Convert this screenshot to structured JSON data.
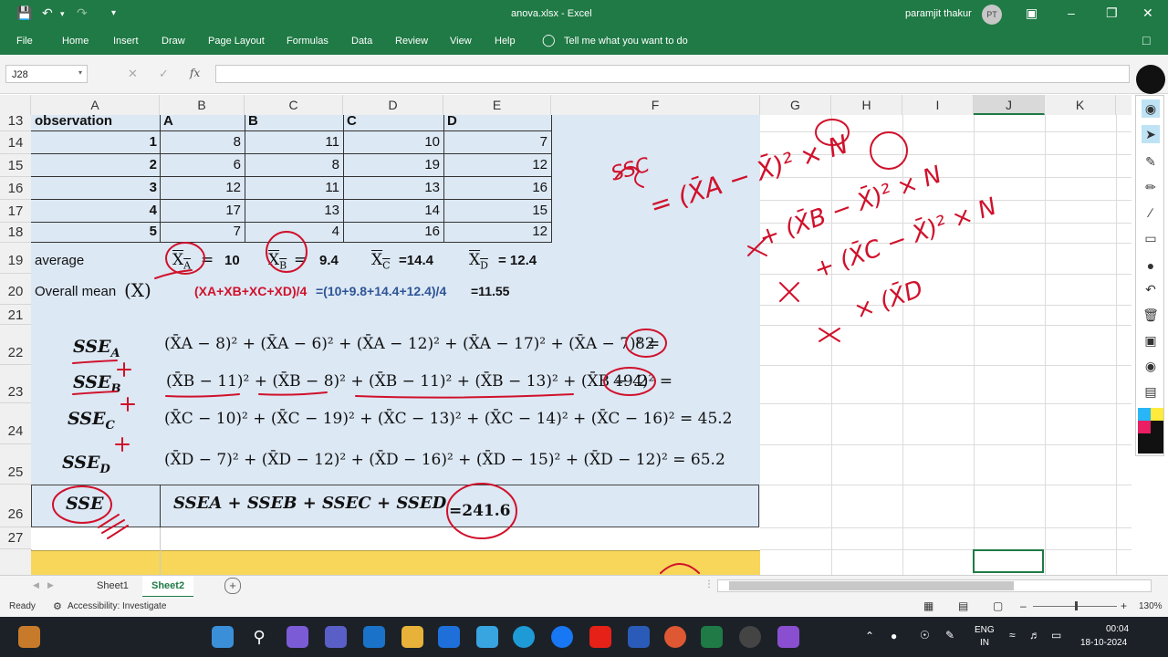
{
  "window": {
    "title": "anova.xlsx  -  Excel",
    "user": "paramjit thakur",
    "user_initials": "PT"
  },
  "ribbon": {
    "tabs": [
      "File",
      "Home",
      "Insert",
      "Draw",
      "Page Layout",
      "Formulas",
      "Data",
      "Review",
      "View",
      "Help"
    ],
    "tell_me": "Tell me what you want to do"
  },
  "formula_bar": {
    "name_box": "J28",
    "fx_label": "fx",
    "value": ""
  },
  "columns": [
    "A",
    "B",
    "C",
    "D",
    "E",
    "F",
    "G",
    "H",
    "I",
    "J",
    "K"
  ],
  "rows": [
    "13",
    "14",
    "15",
    "16",
    "17",
    "18",
    "19",
    "20",
    "21",
    "22",
    "23",
    "24",
    "25",
    "26",
    "27"
  ],
  "table": {
    "headers": [
      "observation",
      "A",
      "B",
      "C",
      "D"
    ],
    "data": [
      [
        "1",
        "8",
        "11",
        "10",
        "7"
      ],
      [
        "2",
        "6",
        "8",
        "19",
        "12"
      ],
      [
        "3",
        "12",
        "11",
        "13",
        "16"
      ],
      [
        "4",
        "17",
        "13",
        "14",
        "15"
      ],
      [
        "5",
        "7",
        "4",
        "16",
        "12"
      ]
    ]
  },
  "averages": {
    "label": "average",
    "xa": "X",
    "xa_sub": "A",
    "xa_val": "10",
    "xb": "X",
    "xb_sub": "B",
    "xb_val": "9.4",
    "xc": "X",
    "xc_sub": "C",
    "xc_val": "=14.4",
    "xd": "X",
    "xd_sub": "D",
    "xd_val": "=  12.4",
    "eq": "="
  },
  "overall": {
    "label": "Overall mean",
    "symbol": "(X)",
    "formula_red": "(XA+XB+XC+XD)/4",
    "formula_blue": "=(10+9.8+14.4+12.4)/4",
    "result": "=11.55"
  },
  "sse": {
    "a_label": "SSE",
    "a_sub": "A",
    "a_eq": "(X̄A − 8)² + (X̄A − 6)² + (X̄A − 12)² + (X̄A − 17)² + (X̄A − 7)² =",
    "a_val": "82",
    "b_label": "SSE",
    "b_sub": "B",
    "b_eq": "(X̄B − 11)² + (X̄B − 8)² + (X̄B − 11)² + (X̄B − 13)² + (X̄B − 4)² =",
    "b_val": "49.2",
    "c_label": "SSE",
    "c_sub": "C",
    "c_eq": "(X̄C − 10)² + (X̄C − 19)² + (X̄C − 13)² + (X̄C − 14)² + (X̄C − 16)² = 45.2",
    "d_label": "SSE",
    "d_sub": "D",
    "d_eq": "(X̄D − 7)² + (X̄D − 12)² + (X̄D − 16)² + (X̄D − 15)² + (X̄D − 12)² = 65.2",
    "total_label": "SSE",
    "total_eq": "SSEA + SSEB + SSEC + SSED",
    "total_val": "=241.6"
  },
  "ink": {
    "ssc": "SSC",
    "line1": "= (X̄A − X̄)² × N",
    "line2": "+ (X̄B − X̄)² × N",
    "line3": "+ (X̄C − X̄)² × N",
    "line4": "× (X̄D",
    "line5": "×"
  },
  "sheets": [
    "Sheet1",
    "Sheet2"
  ],
  "active_sheet": "Sheet2",
  "status": {
    "ready": "Ready",
    "accessibility": "Accessibility: Investigate",
    "zoom": "130%"
  },
  "taskbar": {
    "lang1": "ENG",
    "lang2": "IN",
    "time": "00:04",
    "date": "18-10-2024"
  },
  "colors": {
    "excel_green": "#1f7a45",
    "ink_red": "#d0112b",
    "cell_blue": "#dce8f4",
    "highlight_yellow": "#f7d65a"
  }
}
